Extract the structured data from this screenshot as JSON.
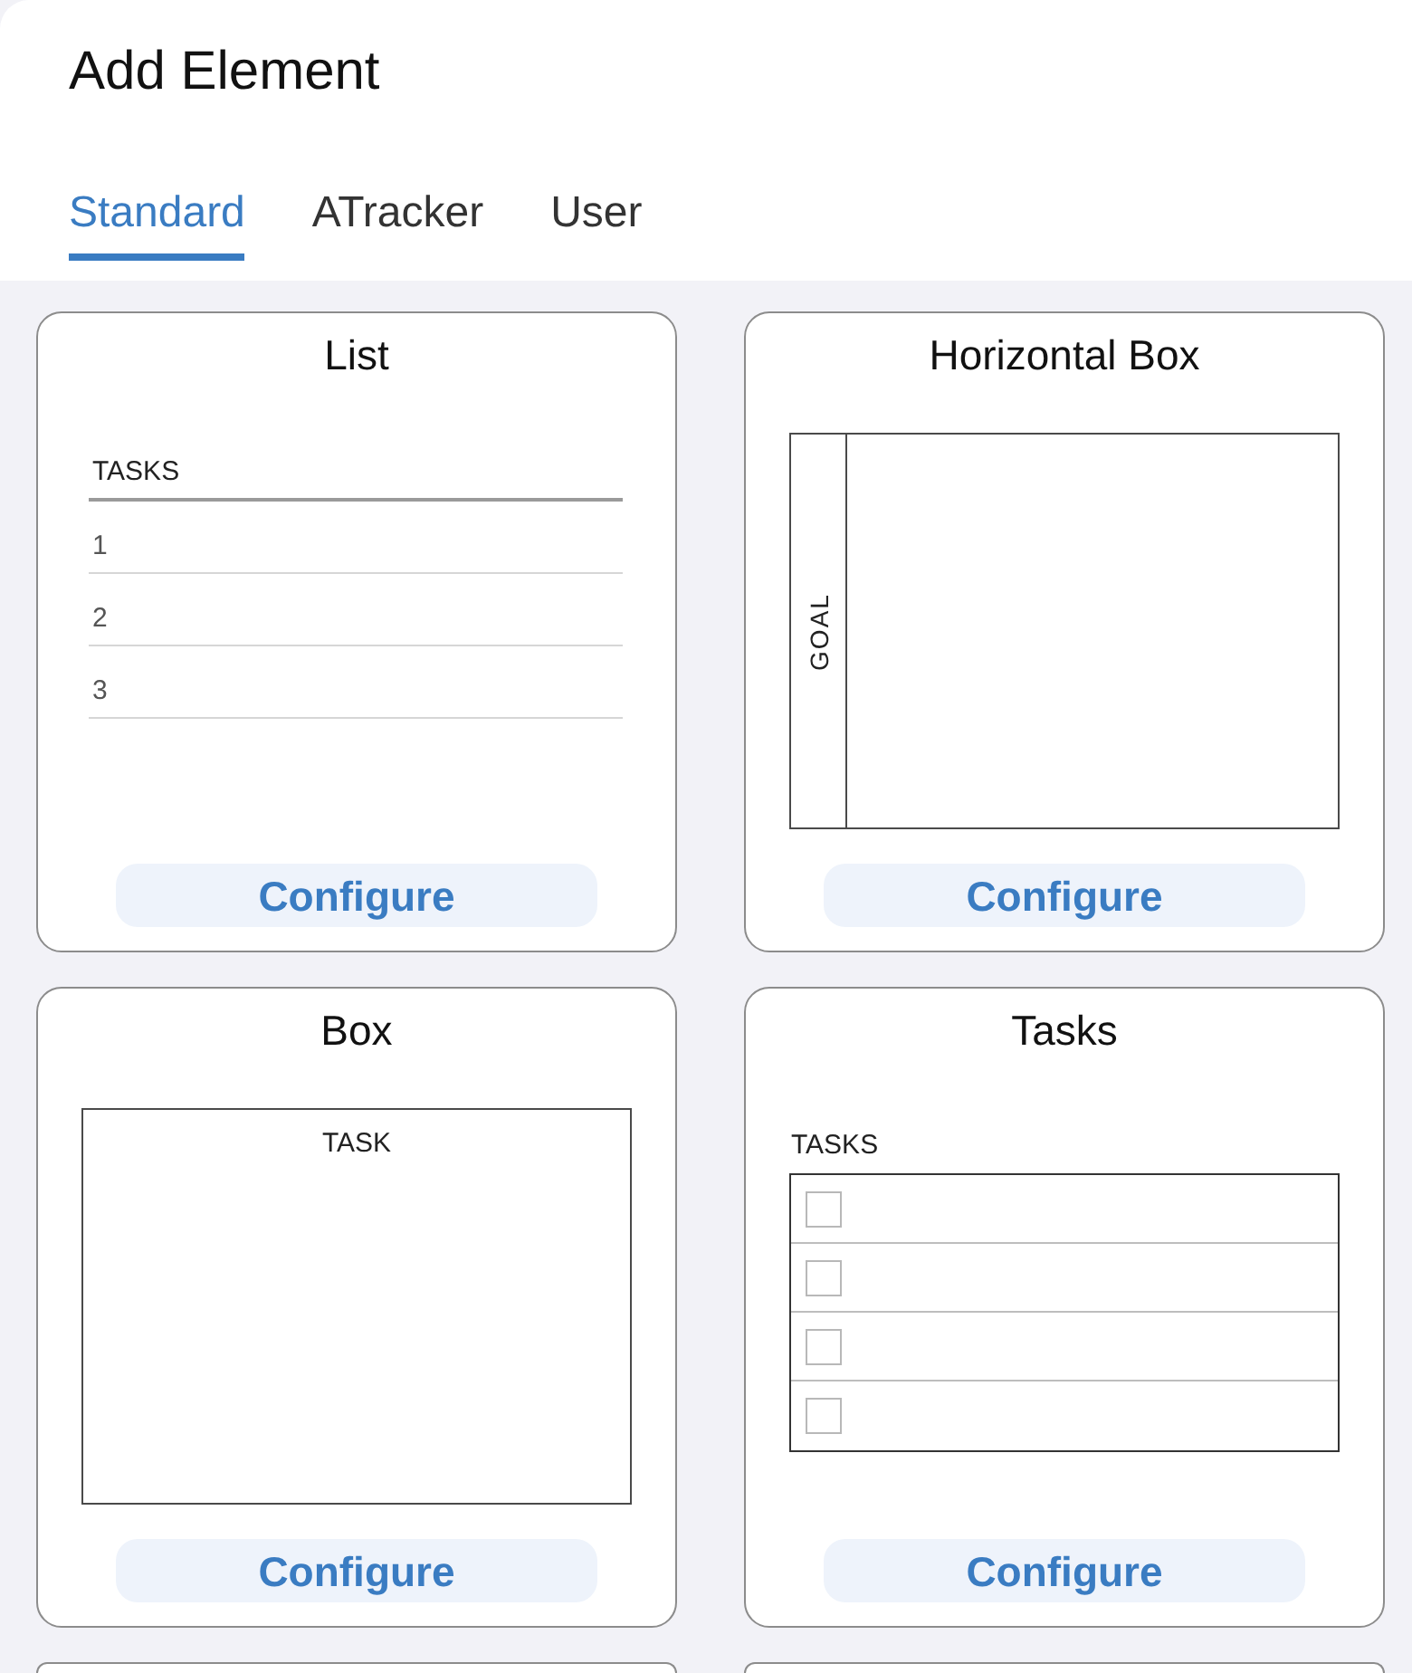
{
  "sheet": {
    "title": "Add Element"
  },
  "tabs": [
    {
      "label": "Standard",
      "selected": true
    },
    {
      "label": "ATracker",
      "selected": false
    },
    {
      "label": "User",
      "selected": false
    }
  ],
  "cards": [
    {
      "kind": "list",
      "title": "List",
      "preview": {
        "header": "TASKS",
        "rows": [
          "1",
          "2",
          "3"
        ]
      },
      "button": "Configure"
    },
    {
      "kind": "horizontal_box",
      "title": "Horizontal Box",
      "preview": {
        "side_label": "GOAL"
      },
      "button": "Configure"
    },
    {
      "kind": "box",
      "title": "Box",
      "preview": {
        "label": "TASK"
      },
      "button": "Configure"
    },
    {
      "kind": "tasks",
      "title": "Tasks",
      "preview": {
        "header": "TASKS",
        "rows": [
          {
            "checked": false
          },
          {
            "checked": false
          },
          {
            "checked": false
          },
          {
            "checked": false
          }
        ]
      },
      "button": "Configure"
    },
    {
      "kind": "cut_off"
    },
    {
      "kind": "cut_off"
    }
  ]
}
